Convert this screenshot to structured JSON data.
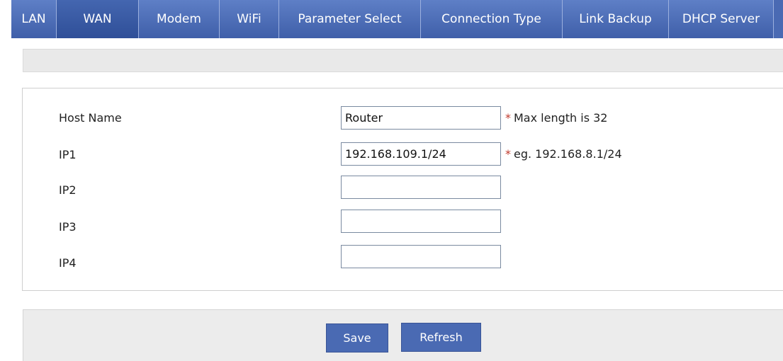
{
  "tabs": [
    {
      "label": "LAN",
      "active": false
    },
    {
      "label": "WAN",
      "active": true
    },
    {
      "label": "Modem",
      "active": false
    },
    {
      "label": "WiFi",
      "active": false
    },
    {
      "label": "Parameter Select",
      "active": false
    },
    {
      "label": "Connection Type",
      "active": false
    },
    {
      "label": "Link Backup",
      "active": false
    },
    {
      "label": "DHCP Server",
      "active": false
    }
  ],
  "form": {
    "host_name": {
      "label": "Host Name",
      "value": "Router",
      "hint": "Max length is 32"
    },
    "ip1": {
      "label": "IP1",
      "value": "192.168.109.1/24",
      "hint": "eg. 192.168.8.1/24"
    },
    "ip2": {
      "label": "IP2",
      "value": ""
    },
    "ip3": {
      "label": "IP3",
      "value": ""
    },
    "ip4": {
      "label": "IP4",
      "value": ""
    },
    "required_marker": "*"
  },
  "actions": {
    "save_label": "Save",
    "refresh_label": "Refresh"
  },
  "colors": {
    "tab_bg": "#4a6ab3",
    "button_bg": "#4a6ab3",
    "required": "#c0392b"
  }
}
